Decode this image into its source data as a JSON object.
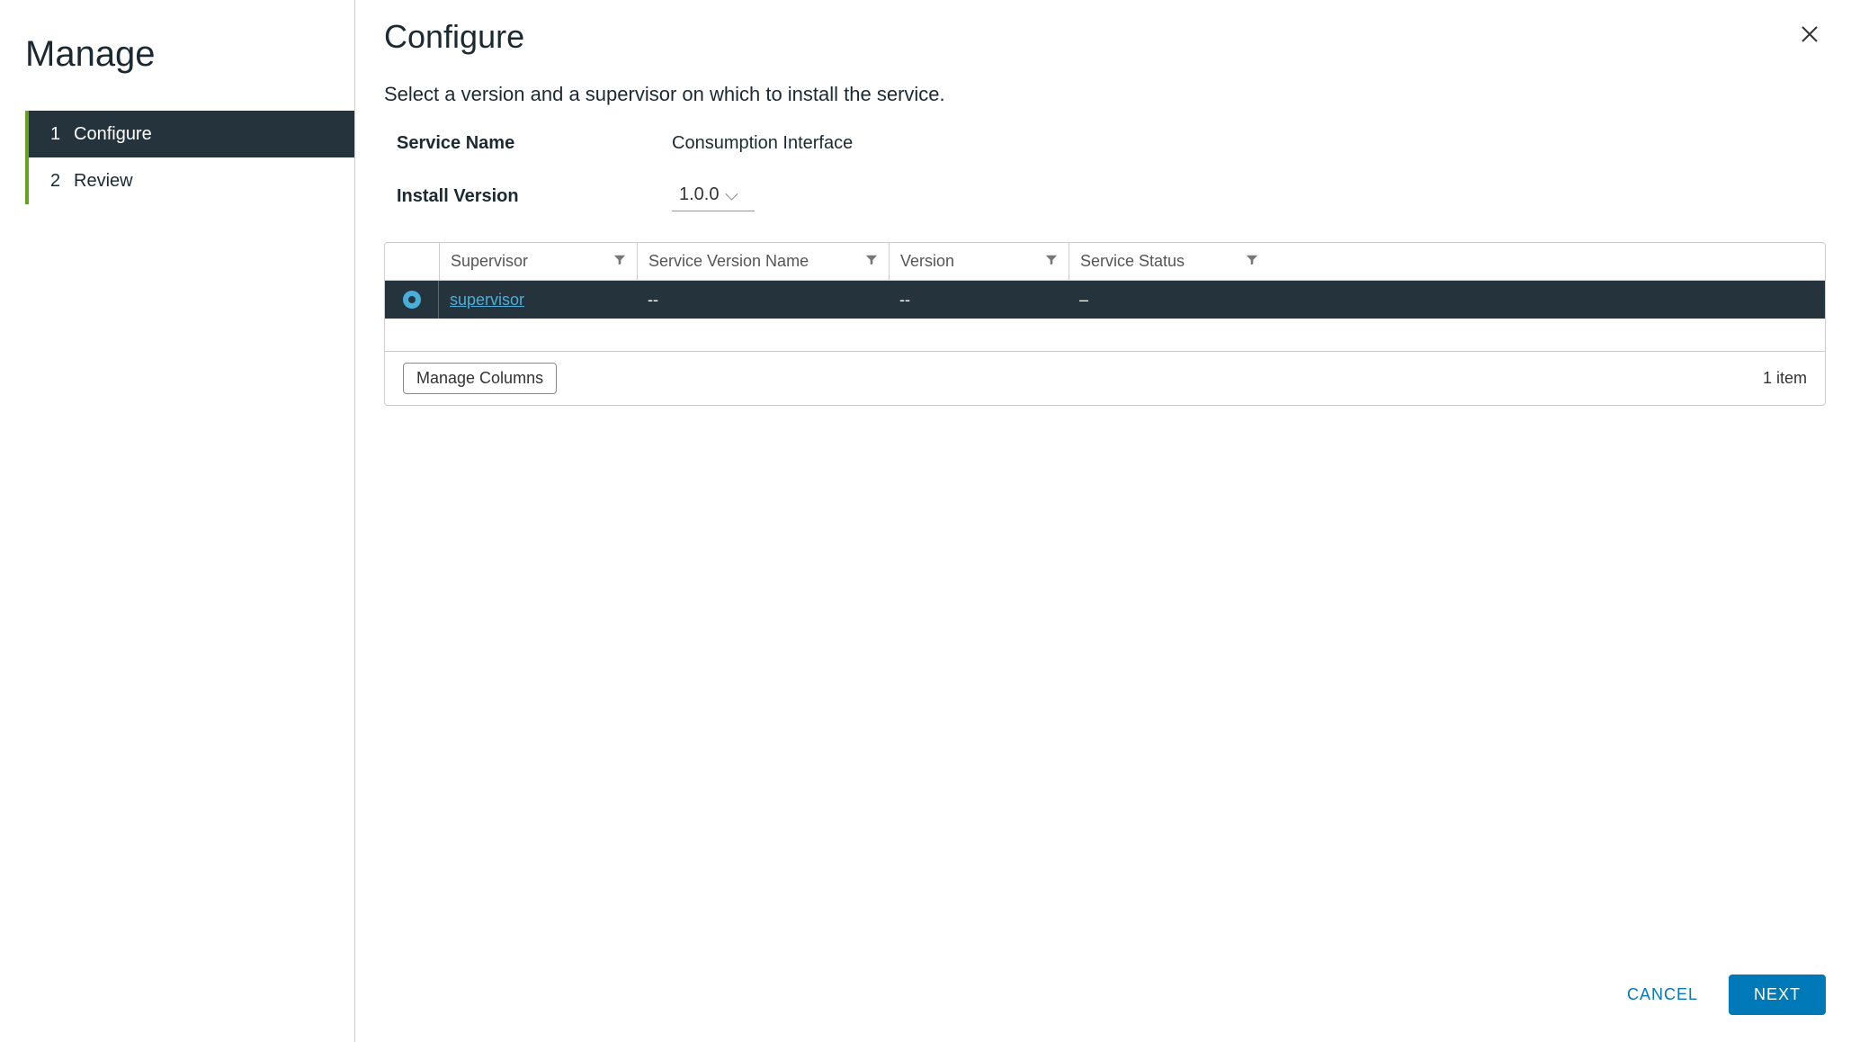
{
  "sidebar": {
    "title": "Manage",
    "steps": [
      {
        "num": "1",
        "label": "Configure",
        "active": true
      },
      {
        "num": "2",
        "label": "Review",
        "active": false
      }
    ]
  },
  "main": {
    "title": "Configure",
    "description": "Select a version and a supervisor on which to install the service.",
    "service_name_label": "Service Name",
    "service_name_value": "Consumption Interface",
    "install_version_label": "Install Version",
    "install_version_value": "1.0.0"
  },
  "table": {
    "columns": {
      "supervisor": "Supervisor",
      "service_version_name": "Service Version Name",
      "version": "Version",
      "service_status": "Service Status"
    },
    "rows": [
      {
        "selected": true,
        "supervisor": "supervisor",
        "service_version_name": "--",
        "version": "--",
        "service_status": "–"
      }
    ],
    "manage_columns_label": "Manage Columns",
    "item_count": "1 item"
  },
  "footer": {
    "cancel": "CANCEL",
    "next": "NEXT"
  }
}
